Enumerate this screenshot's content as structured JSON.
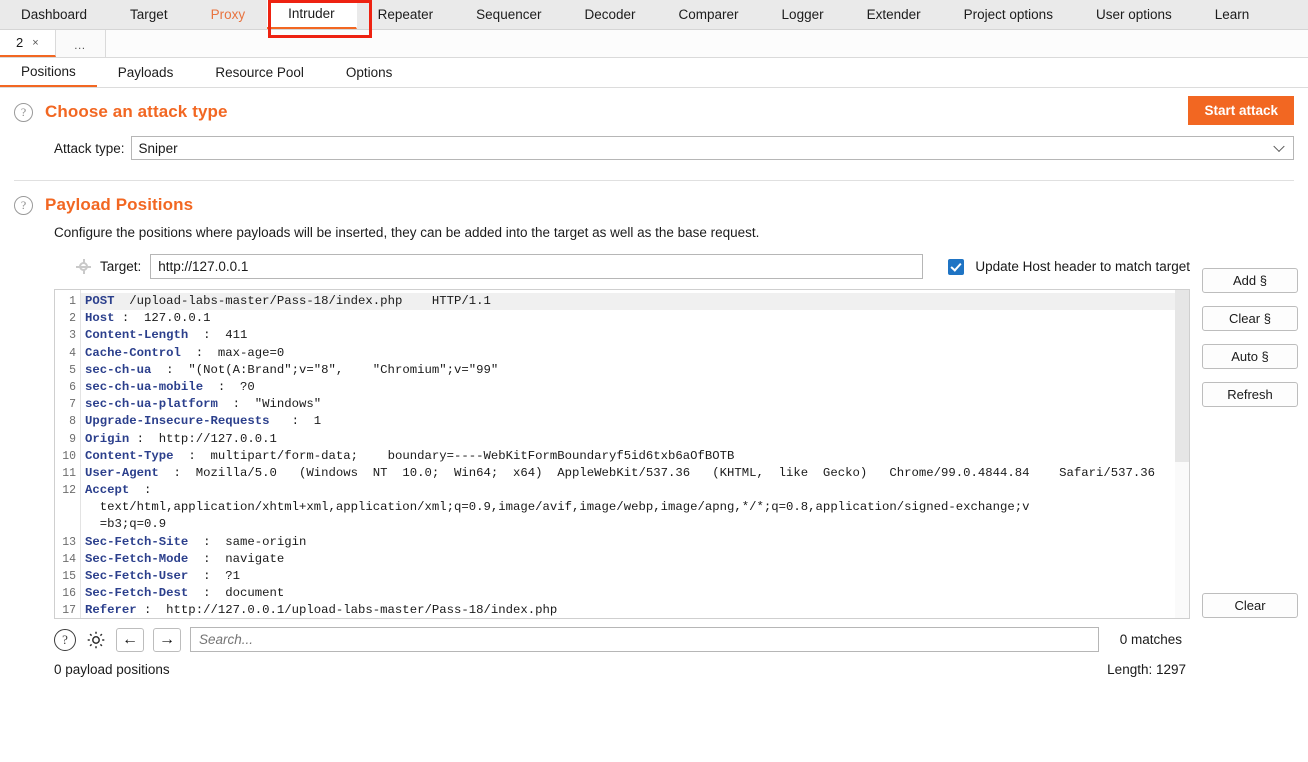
{
  "main_tabs": [
    {
      "label": "Dashboard",
      "state": "normal"
    },
    {
      "label": "Target",
      "state": "normal"
    },
    {
      "label": "Proxy",
      "state": "proxy"
    },
    {
      "label": "Intruder",
      "state": "active"
    },
    {
      "label": "Repeater",
      "state": "normal"
    },
    {
      "label": "Sequencer",
      "state": "normal"
    },
    {
      "label": "Decoder",
      "state": "normal"
    },
    {
      "label": "Comparer",
      "state": "normal"
    },
    {
      "label": "Logger",
      "state": "normal"
    },
    {
      "label": "Extender",
      "state": "normal"
    },
    {
      "label": "Project options",
      "state": "normal"
    },
    {
      "label": "User options",
      "state": "normal"
    },
    {
      "label": "Learn",
      "state": "normal"
    }
  ],
  "instance_tabs": {
    "active_label": "2",
    "close_glyph": "×",
    "more_label": "…"
  },
  "sub_tabs": [
    {
      "label": "Positions",
      "active": true
    },
    {
      "label": "Payloads",
      "active": false
    },
    {
      "label": "Resource Pool",
      "active": false
    },
    {
      "label": "Options",
      "active": false
    }
  ],
  "attack_type_section": {
    "help_glyph": "?",
    "title": "Choose an attack type",
    "field_label": "Attack type:",
    "selected_value": "Sniper",
    "start_button": "Start attack"
  },
  "payload_positions_section": {
    "help_glyph": "?",
    "title": "Payload Positions",
    "description": "Configure the positions where payloads will be inserted, they can be added into the target as well as the base request."
  },
  "target": {
    "label": "Target:",
    "value": "http://127.0.0.1",
    "checkbox_label": "Update Host header to match target",
    "checkbox_checked": true
  },
  "side_buttons": [
    {
      "label": "Add §"
    },
    {
      "label": "Clear §"
    },
    {
      "label": "Auto §"
    },
    {
      "label": "Refresh"
    }
  ],
  "request": {
    "lines": [
      {
        "num": "1",
        "highlight": true,
        "header": "POST",
        "rest": "  /upload-labs-master/Pass-18/index.php    HTTP/1.1"
      },
      {
        "num": "2",
        "highlight": false,
        "header": "Host",
        "rest": " :  127.0.0.1"
      },
      {
        "num": "3",
        "highlight": false,
        "header": "Content-Length",
        "rest": "  :  411"
      },
      {
        "num": "4",
        "highlight": false,
        "header": "Cache-Control",
        "rest": "  :  max-age=0"
      },
      {
        "num": "5",
        "highlight": false,
        "header": "sec-ch-ua",
        "rest": "  :  \"(Not(A:Brand\";v=\"8\",    \"Chromium\";v=\"99\""
      },
      {
        "num": "6",
        "highlight": false,
        "header": "sec-ch-ua-mobile",
        "rest": "  :  ?0"
      },
      {
        "num": "7",
        "highlight": false,
        "header": "sec-ch-ua-platform",
        "rest": "  :  \"Windows\""
      },
      {
        "num": "8",
        "highlight": false,
        "header": "Upgrade-Insecure-Requests",
        "rest": "   :  1"
      },
      {
        "num": "9",
        "highlight": false,
        "header": "Origin",
        "rest": " :  http://127.0.0.1"
      },
      {
        "num": "10",
        "highlight": false,
        "header": "Content-Type",
        "rest": "  :  multipart/form-data;    boundary=----WebKitFormBoundaryf5id6txb6aOfBOTB"
      },
      {
        "num": "11",
        "highlight": false,
        "header": "User-Agent",
        "rest": "  :  Mozilla/5.0   (Windows  NT  10.0;  Win64;  x64)  AppleWebKit/537.36   (KHTML,  like  Gecko)   Chrome/99.0.4844.84    Safari/537.36"
      },
      {
        "num": "12",
        "highlight": false,
        "header": "Accept",
        "rest": "  :"
      },
      {
        "num": "",
        "highlight": false,
        "header": "",
        "rest": "  text/html,application/xhtml+xml,application/xml;q=0.9,image/avif,image/webp,image/apng,*/*;q=0.8,application/signed-exchange;v"
      },
      {
        "num": "",
        "highlight": false,
        "header": "",
        "rest": "  =b3;q=0.9"
      },
      {
        "num": "13",
        "highlight": false,
        "header": "Sec-Fetch-Site",
        "rest": "  :  same-origin"
      },
      {
        "num": "14",
        "highlight": false,
        "header": "Sec-Fetch-Mode",
        "rest": "  :  navigate"
      },
      {
        "num": "15",
        "highlight": false,
        "header": "Sec-Fetch-User",
        "rest": "  :  ?1"
      },
      {
        "num": "16",
        "highlight": false,
        "header": "Sec-Fetch-Dest",
        "rest": "  :  document"
      },
      {
        "num": "17",
        "highlight": false,
        "header": "Referer",
        "rest": " :  http://127.0.0.1/upload-labs-master/Pass-18/index.php"
      }
    ]
  },
  "findbar": {
    "help_glyph": "?",
    "gear_icon": "gear-icon",
    "prev_glyph": "←",
    "next_glyph": "→",
    "search_placeholder": "Search...",
    "search_value": "",
    "matches": "0 matches",
    "clear_button": "Clear"
  },
  "status": {
    "payload_positions": "0 payload positions",
    "length": "Length: 1297"
  },
  "colors": {
    "accent": "#f26722",
    "annotation": "#ee2211",
    "header_blue": "#2b3f8c",
    "checkbox_blue": "#1f74c4"
  }
}
